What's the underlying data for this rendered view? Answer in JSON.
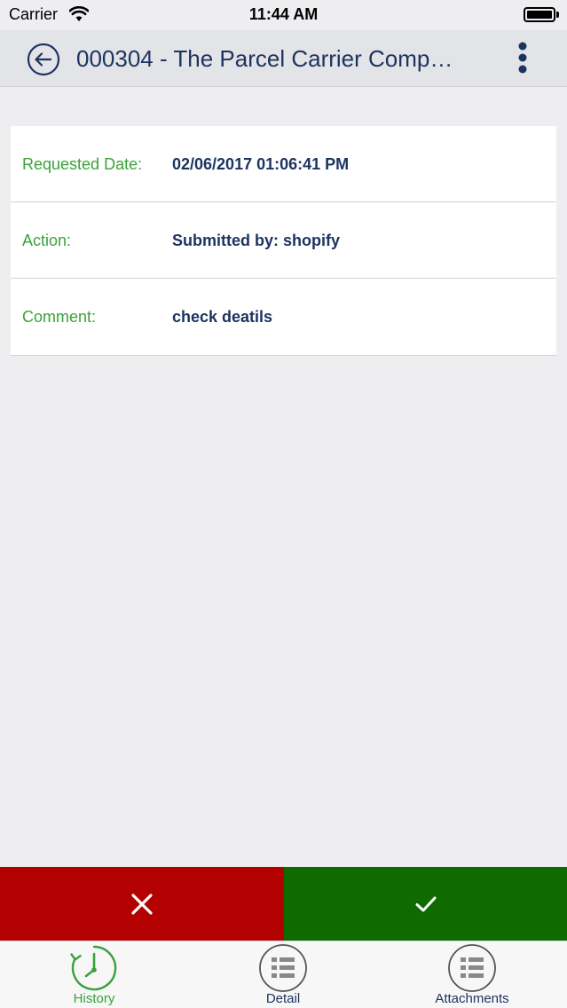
{
  "status_bar": {
    "carrier": "Carrier",
    "time": "11:44 AM"
  },
  "header": {
    "title": "000304 - The Parcel Carrier Comp…"
  },
  "history": {
    "rows": [
      {
        "label": "Requested Date:",
        "value": "02/06/2017 01:06:41 PM"
      },
      {
        "label": "Action:",
        "value": "Submitted by: shopify"
      },
      {
        "label": "Comment:",
        "value": "check deatils"
      }
    ]
  },
  "actions": {
    "reject_icon": "close-icon",
    "approve_icon": "checkmark-icon",
    "reject_color": "#b30000",
    "approve_color": "#0f6b00"
  },
  "tabs": [
    {
      "label": "History",
      "icon": "clock-icon",
      "active": true
    },
    {
      "label": "Detail",
      "icon": "list-icon",
      "active": false
    },
    {
      "label": "Attachments",
      "icon": "list-icon",
      "active": false
    }
  ],
  "colors": {
    "label_green": "#3aa23a",
    "text_navy": "#1d3461"
  }
}
